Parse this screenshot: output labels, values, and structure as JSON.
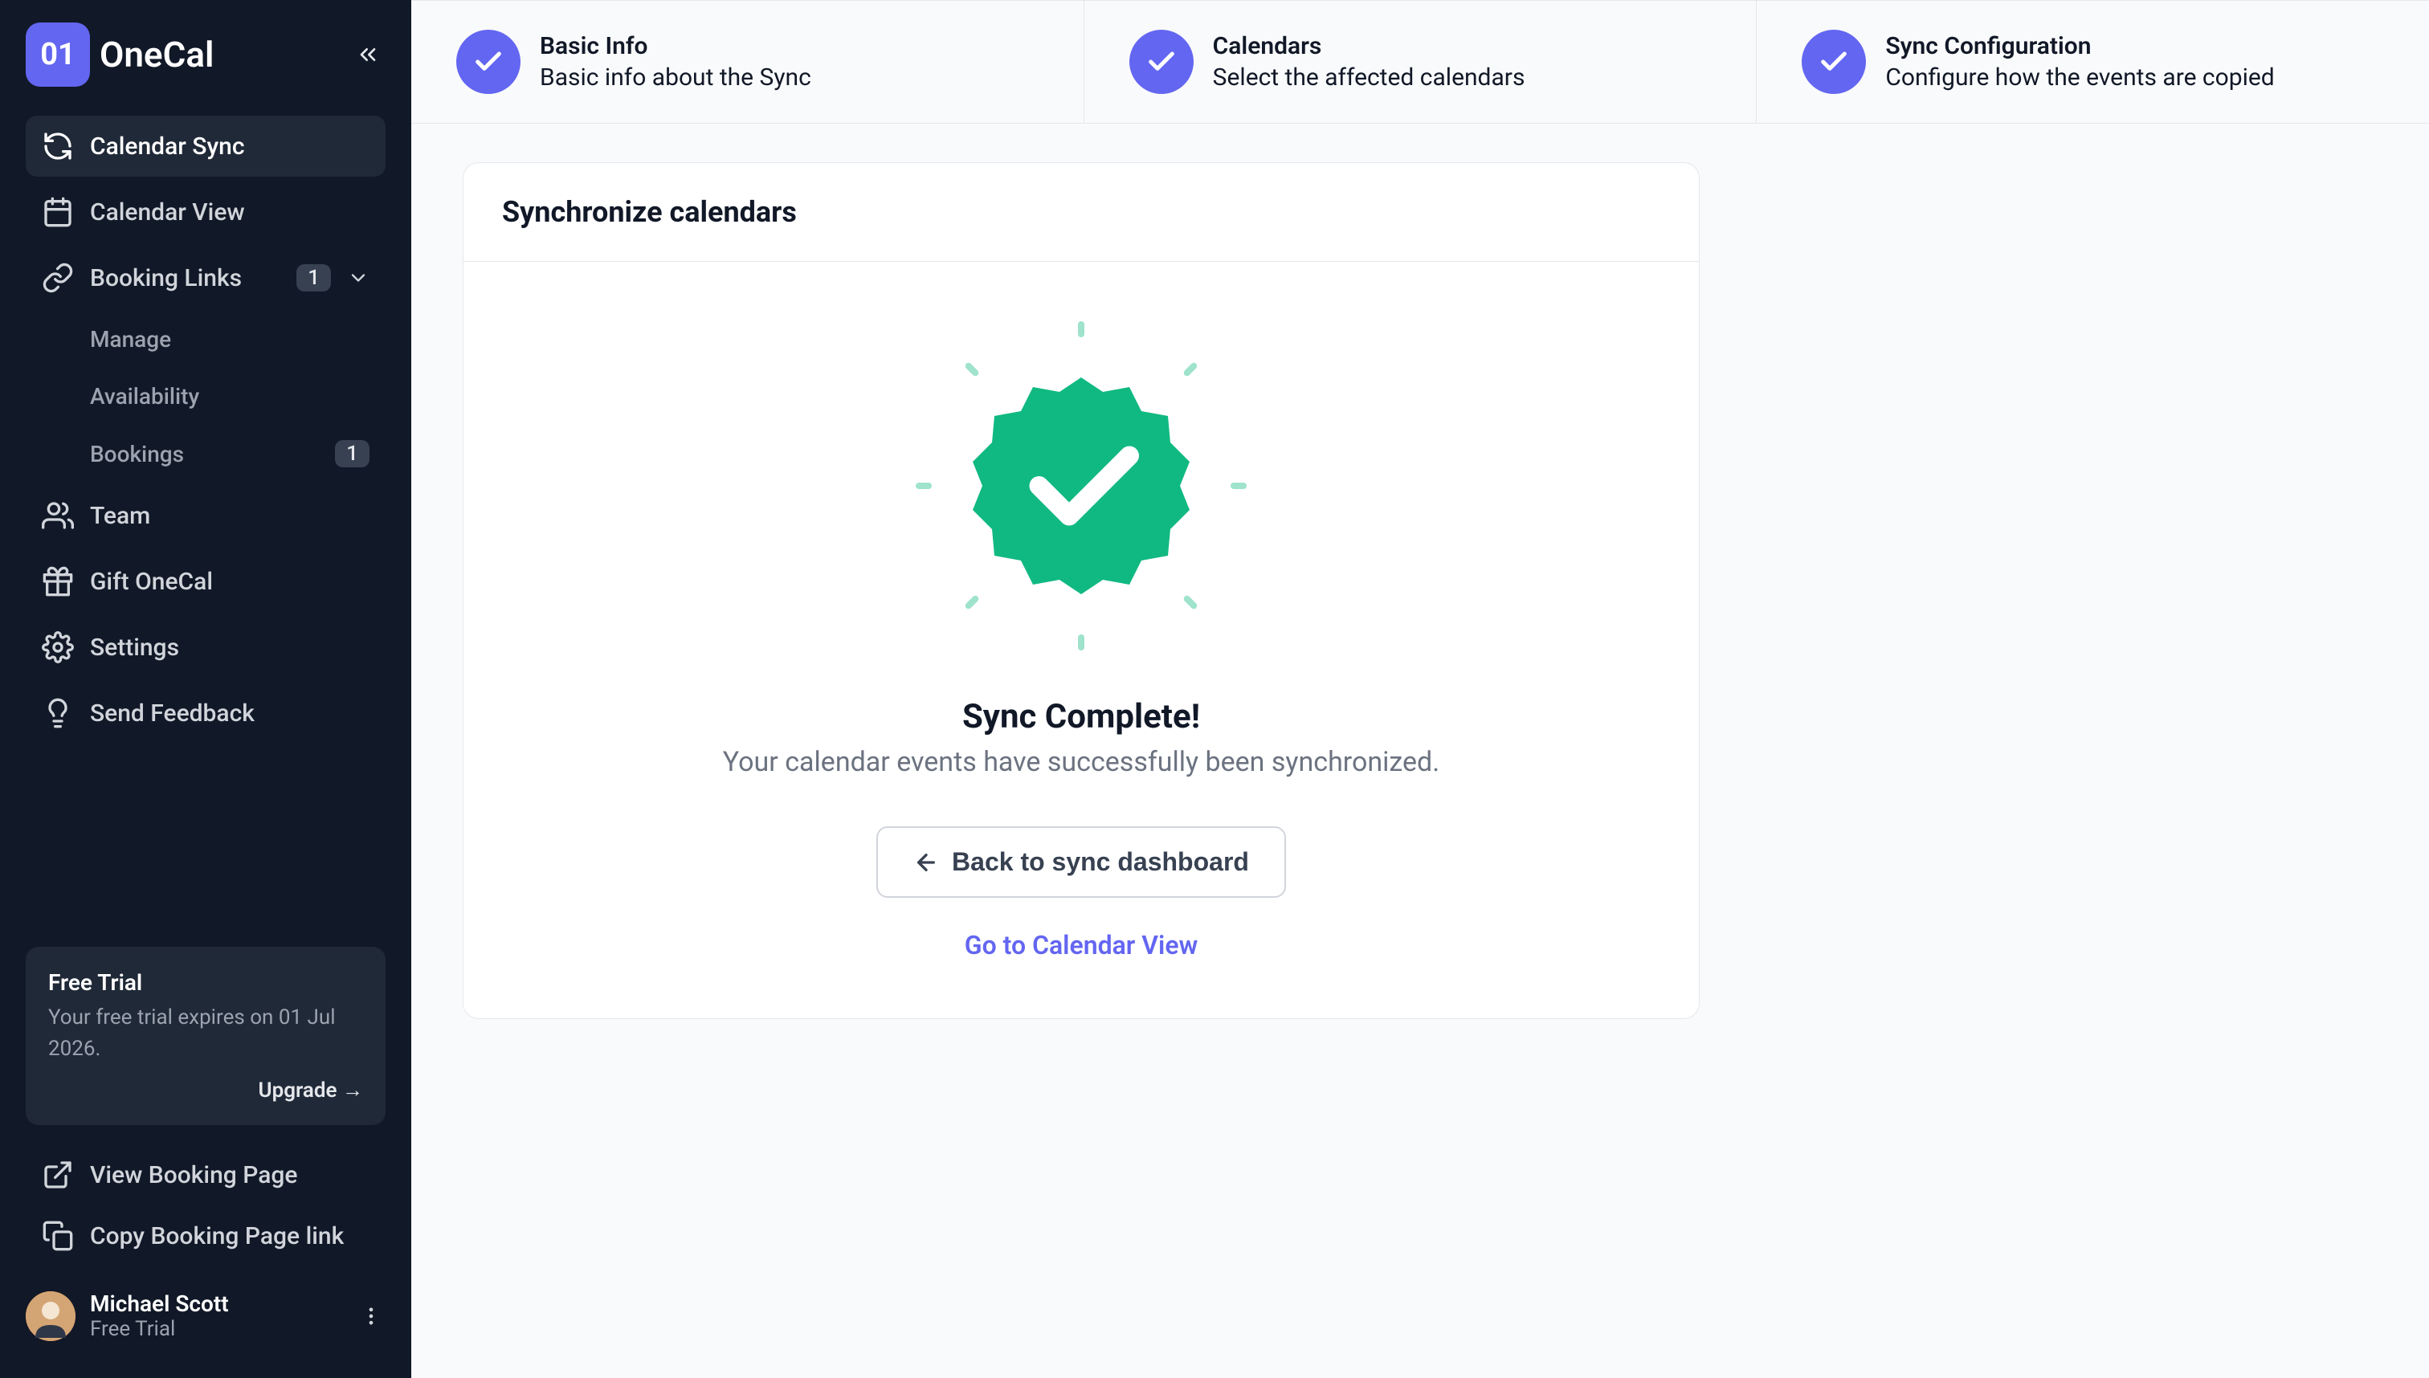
{
  "brand": {
    "name": "OneCal",
    "badge": "01"
  },
  "sidebar": {
    "items": [
      {
        "label": "Calendar Sync"
      },
      {
        "label": "Calendar View"
      },
      {
        "label": "Booking Links",
        "badge": "1"
      },
      {
        "label": "Team"
      },
      {
        "label": "Gift OneCal"
      },
      {
        "label": "Settings"
      },
      {
        "label": "Send Feedback"
      }
    ],
    "sub_items": [
      {
        "label": "Manage"
      },
      {
        "label": "Availability"
      },
      {
        "label": "Bookings",
        "badge": "1"
      }
    ],
    "links": [
      {
        "label": "View Booking Page"
      },
      {
        "label": "Copy Booking Page link"
      }
    ]
  },
  "trial": {
    "title": "Free Trial",
    "desc": "Your free trial expires on 01 Jul 2026.",
    "upgrade": "Upgrade →"
  },
  "user": {
    "name": "Michael Scott",
    "plan": "Free Trial"
  },
  "steps": [
    {
      "title": "Basic Info",
      "desc": "Basic info about the Sync"
    },
    {
      "title": "Calendars",
      "desc": "Select the affected calendars"
    },
    {
      "title": "Sync Configuration",
      "desc": "Configure how the events are copied"
    }
  ],
  "card": {
    "title": "Synchronize calendars",
    "success_title": "Sync Complete!",
    "success_desc": "Your calendar events have successfully been synchronized.",
    "back_btn": "Back to sync dashboard",
    "goto_link": "Go to Calendar View"
  }
}
